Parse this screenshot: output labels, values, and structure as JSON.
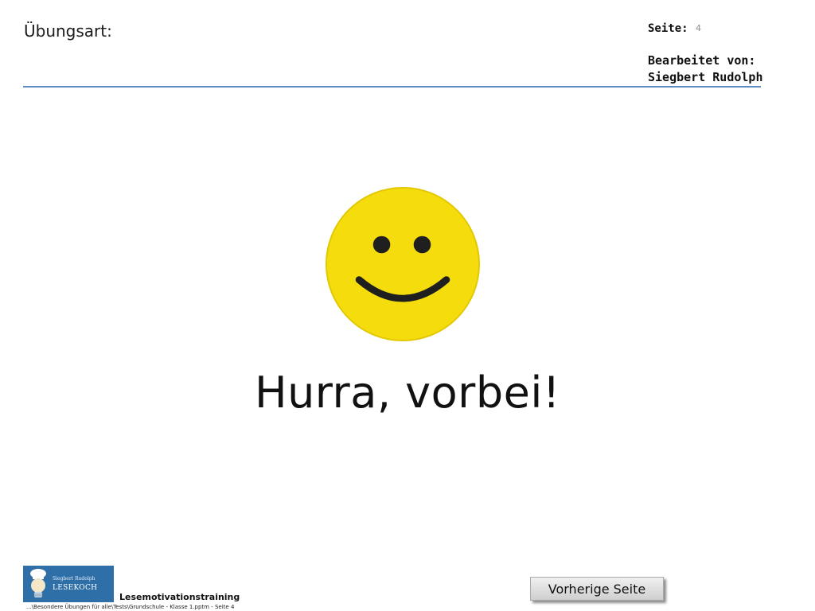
{
  "header": {
    "exercise_type_label": "Übungsart:",
    "page_label": "Seite:",
    "page_number": "4",
    "edited_by_label": "Bearbeitet von:",
    "author": "Siegbert Rudolph"
  },
  "main": {
    "icon": "smiley-face-icon",
    "smiley_color": "#f5dc0c",
    "headline": "Hurra, vorbei!"
  },
  "footer": {
    "logo": {
      "author_name": "Siegbert Rudolph",
      "brand": "LESEKOCH",
      "background_color": "#2f6fa8"
    },
    "course_label": "Lesemotivationstraining",
    "file_path": "...\\Besondere Übungen für alle\\Tests\\Grundschule - Klasse 1.pptm - Seite 4",
    "prev_button_label": "Vorherige Seite"
  },
  "colors": {
    "header_rule": "#5d8cc4"
  }
}
